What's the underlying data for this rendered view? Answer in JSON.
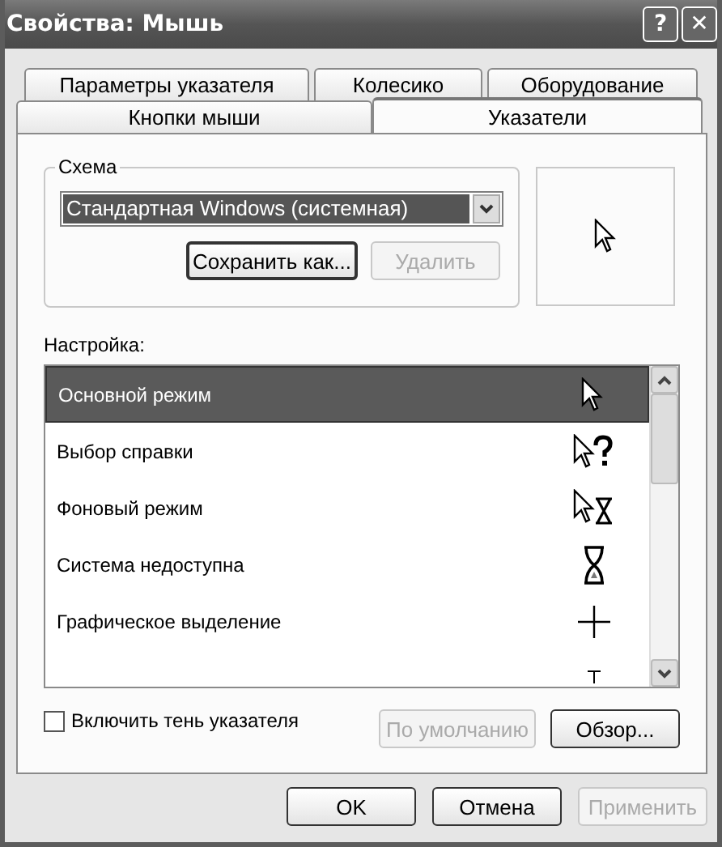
{
  "window": {
    "title": "Свойства: Мышь",
    "help_button": "?",
    "close_button": "✕"
  },
  "tabs_back": [
    {
      "label": "Параметры указателя",
      "selected": false
    },
    {
      "label": "Колесико",
      "selected": false
    },
    {
      "label": "Оборудование",
      "selected": false
    }
  ],
  "tabs_front": [
    {
      "label": "Кнопки мыши",
      "selected": false
    },
    {
      "label": "Указатели",
      "selected": true
    }
  ],
  "scheme": {
    "label": "Схема",
    "value": "Стандартная Windows (системная)",
    "save_button": "Сохранить как...",
    "delete_button": {
      "label": "Удалить",
      "disabled": true
    }
  },
  "customize": {
    "label": "Настройка:",
    "items": [
      {
        "label": "Основной режим",
        "kind": "arrow",
        "selected": true
      },
      {
        "label": "Выбор справки",
        "kind": "help",
        "selected": false
      },
      {
        "label": "Фоновый режим",
        "kind": "working",
        "selected": false
      },
      {
        "label": "Система недоступна",
        "kind": "busy",
        "selected": false
      },
      {
        "label": "Графическое выделение",
        "kind": "cross",
        "selected": false
      },
      {
        "kind": "text",
        "selected": false
      }
    ]
  },
  "shadow_checkbox": {
    "label": "Включить тень указателя",
    "checked": false
  },
  "default_button": {
    "label": "По умолчанию",
    "disabled": true
  },
  "browse_button": {
    "label": "Обзор...",
    "disabled": false
  },
  "buttons": [
    {
      "label": "OK",
      "disabled": false
    },
    {
      "label": "Отмена",
      "disabled": false
    },
    {
      "label": "Применить",
      "disabled": true
    }
  ]
}
